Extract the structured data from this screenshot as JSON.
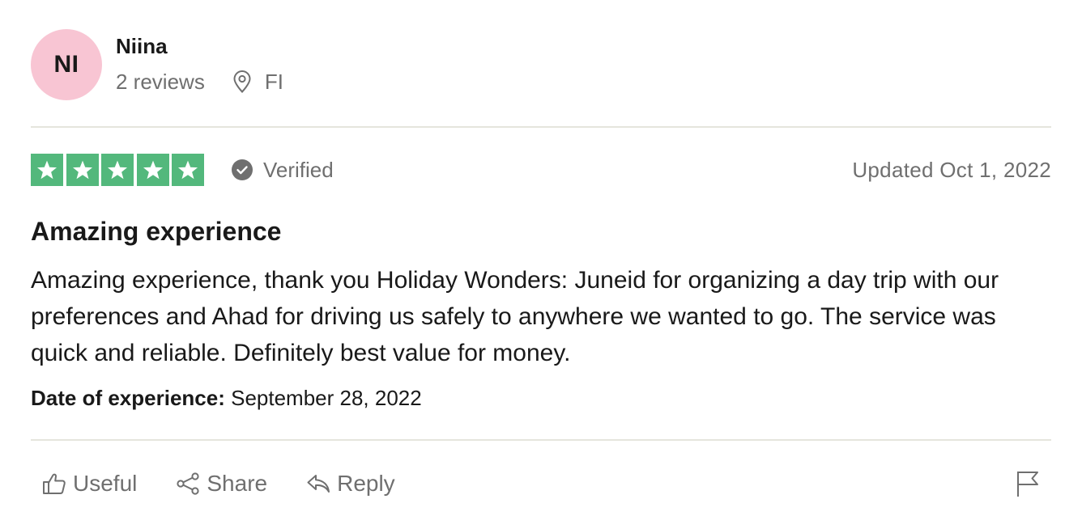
{
  "consumer": {
    "initials": "NI",
    "name": "Niina",
    "reviews_count": "2 reviews",
    "country": "FI",
    "avatar_color": "#f8c5d3"
  },
  "rating": {
    "stars": 5,
    "star_color": "#53b87c",
    "verified_label": "Verified",
    "date_label": "Updated Oct 1, 2022"
  },
  "review": {
    "title": "Amazing experience",
    "body": "Amazing experience, thank you Holiday Wonders: Juneid for organizing a day trip with our preferences and Ahad for driving us safely to anywhere we wanted to go. The service was quick and reliable. Definitely best value for money.",
    "experience_label": "Date of experience:",
    "experience_date": "September 28, 2022"
  },
  "actions": {
    "useful_label": "Useful",
    "share_label": "Share",
    "reply_label": "Reply"
  },
  "icons": {
    "location": "location-pin-icon",
    "verified": "check-circle-icon",
    "useful": "thumbs-up-icon",
    "share": "share-icon",
    "reply": "reply-icon",
    "report": "flag-icon"
  }
}
